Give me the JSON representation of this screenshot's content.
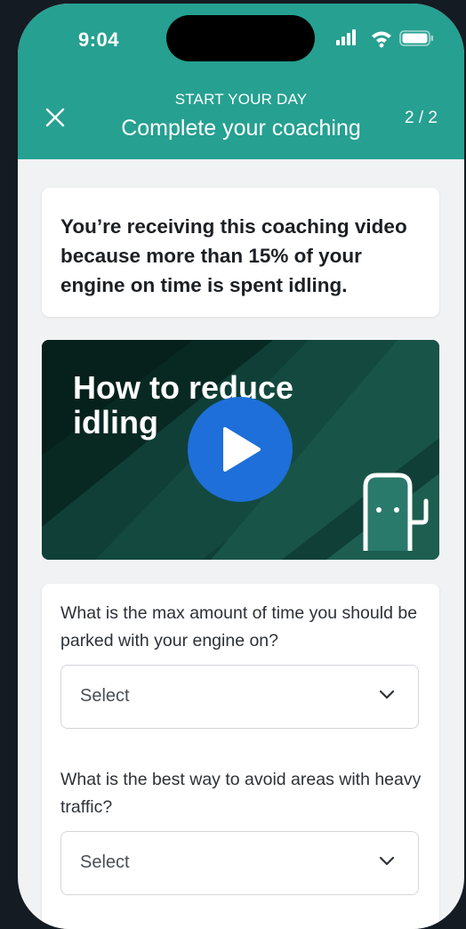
{
  "status_bar": {
    "time": "9:04",
    "icons": [
      "signal-icon",
      "wifi-icon",
      "battery-icon"
    ]
  },
  "header": {
    "kicker": "START YOUR DAY",
    "title": "Complete your coaching",
    "step": "2 / 2",
    "close_icon": "close-icon",
    "color": "#26a091"
  },
  "info": {
    "text": "You’re receiving this coaching video because more than 15% of your engine on time is spent idling."
  },
  "video": {
    "title": "How to reduce idling",
    "play_icon": "play-icon",
    "fuel_icon": "fuel-pump-icon",
    "background_color": "#0d3b33",
    "play_color": "#1e6fd9"
  },
  "questions": [
    {
      "text": "What is the max amount of time you should be parked with your engine on?",
      "select_value": "Select"
    },
    {
      "text": "What is the best way to avoid areas with heavy traffic?",
      "select_value": "Select"
    }
  ]
}
